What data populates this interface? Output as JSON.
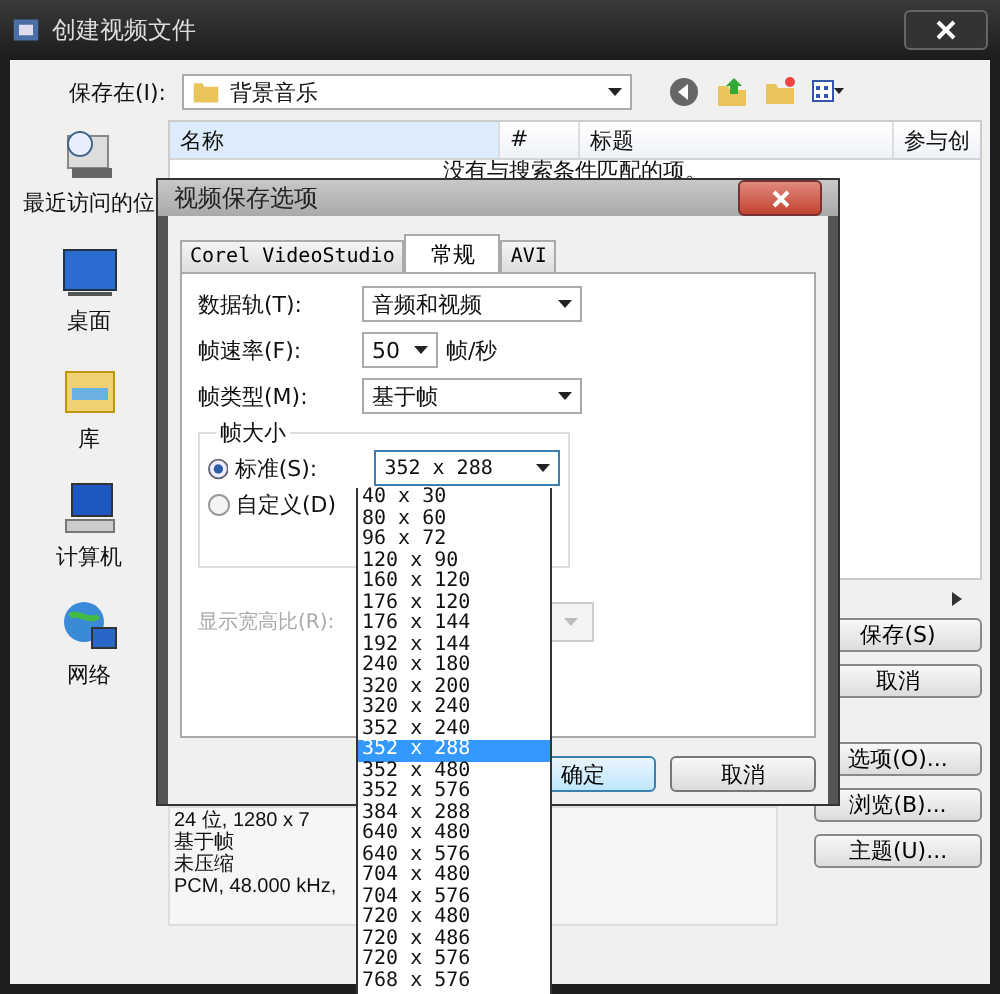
{
  "window": {
    "title": "创建视频文件"
  },
  "save_in": {
    "label": "保存在(I):",
    "value": "背景音乐"
  },
  "places": [
    {
      "label": "最近访问的位",
      "kind": "recent"
    },
    {
      "label": "桌面",
      "kind": "desktop"
    },
    {
      "label": "库",
      "kind": "library"
    },
    {
      "label": "计算机",
      "kind": "computer"
    },
    {
      "label": "网络",
      "kind": "network"
    }
  ],
  "file_list": {
    "columns": [
      "名称",
      "#",
      "标题",
      "参与创"
    ],
    "empty_message": "没有与搜索条件匹配的项。"
  },
  "file_info": [
    "24 位, 1280 x 7",
    "基于帧",
    "未压缩",
    "PCM, 48.000 kHz,"
  ],
  "buttons": [
    {
      "label": "保存(S)"
    },
    {
      "label": "取消"
    },
    {
      "label": "选项(O)..."
    },
    {
      "label": "浏览(B)..."
    },
    {
      "label": "主题(U)..."
    }
  ],
  "dialog": {
    "title": "视频保存选项",
    "tabs": [
      {
        "label": "Corel VideoStudio",
        "selected": false
      },
      {
        "label": "常规",
        "selected": true
      },
      {
        "label": "AVI",
        "selected": false
      }
    ],
    "fields": [
      {
        "label": "数据轨(T):",
        "value": "音频和视频"
      },
      {
        "label": "帧速率(F):",
        "value": "50",
        "unit": "帧/秒"
      },
      {
        "label": "帧类型(M):",
        "value": "基于帧"
      }
    ],
    "frame_size": {
      "title": "帧大小",
      "value": "352 x 288",
      "options": [
        {
          "label": "标准(S):",
          "selected": true
        },
        {
          "label": "自定义(D)",
          "selected": false
        }
      ]
    },
    "aspect": {
      "label": "显示宽高比(R):",
      "disabled": true
    },
    "buttons": [
      {
        "label": "确定",
        "default": true
      },
      {
        "label": "取消",
        "default": false
      }
    ]
  },
  "dropdown": {
    "items": [
      {
        "label": "40 x 30",
        "selected": false
      },
      {
        "label": "80 x 60",
        "selected": false
      },
      {
        "label": "96 x 72",
        "selected": false
      },
      {
        "label": "120 x 90",
        "selected": false
      },
      {
        "label": "160 x 120",
        "selected": false
      },
      {
        "label": "176 x 120",
        "selected": false
      },
      {
        "label": "176 x 144",
        "selected": false
      },
      {
        "label": "192 x 144",
        "selected": false
      },
      {
        "label": "240 x 180",
        "selected": false
      },
      {
        "label": "320 x 200",
        "selected": false
      },
      {
        "label": "320 x 240",
        "selected": false
      },
      {
        "label": "352 x 240",
        "selected": false
      },
      {
        "label": "352 x 288",
        "selected": true
      },
      {
        "label": "352 x 480",
        "selected": false
      },
      {
        "label": "352 x 576",
        "selected": false
      },
      {
        "label": "384 x 288",
        "selected": false
      },
      {
        "label": "640 x 480",
        "selected": false
      },
      {
        "label": "640 x 576",
        "selected": false
      },
      {
        "label": "704 x 480",
        "selected": false
      },
      {
        "label": "704 x 576",
        "selected": false
      },
      {
        "label": "720 x 480",
        "selected": false
      },
      {
        "label": "720 x 486",
        "selected": false
      },
      {
        "label": "720 x 576",
        "selected": false
      },
      {
        "label": "768 x 576",
        "selected": false
      }
    ]
  }
}
